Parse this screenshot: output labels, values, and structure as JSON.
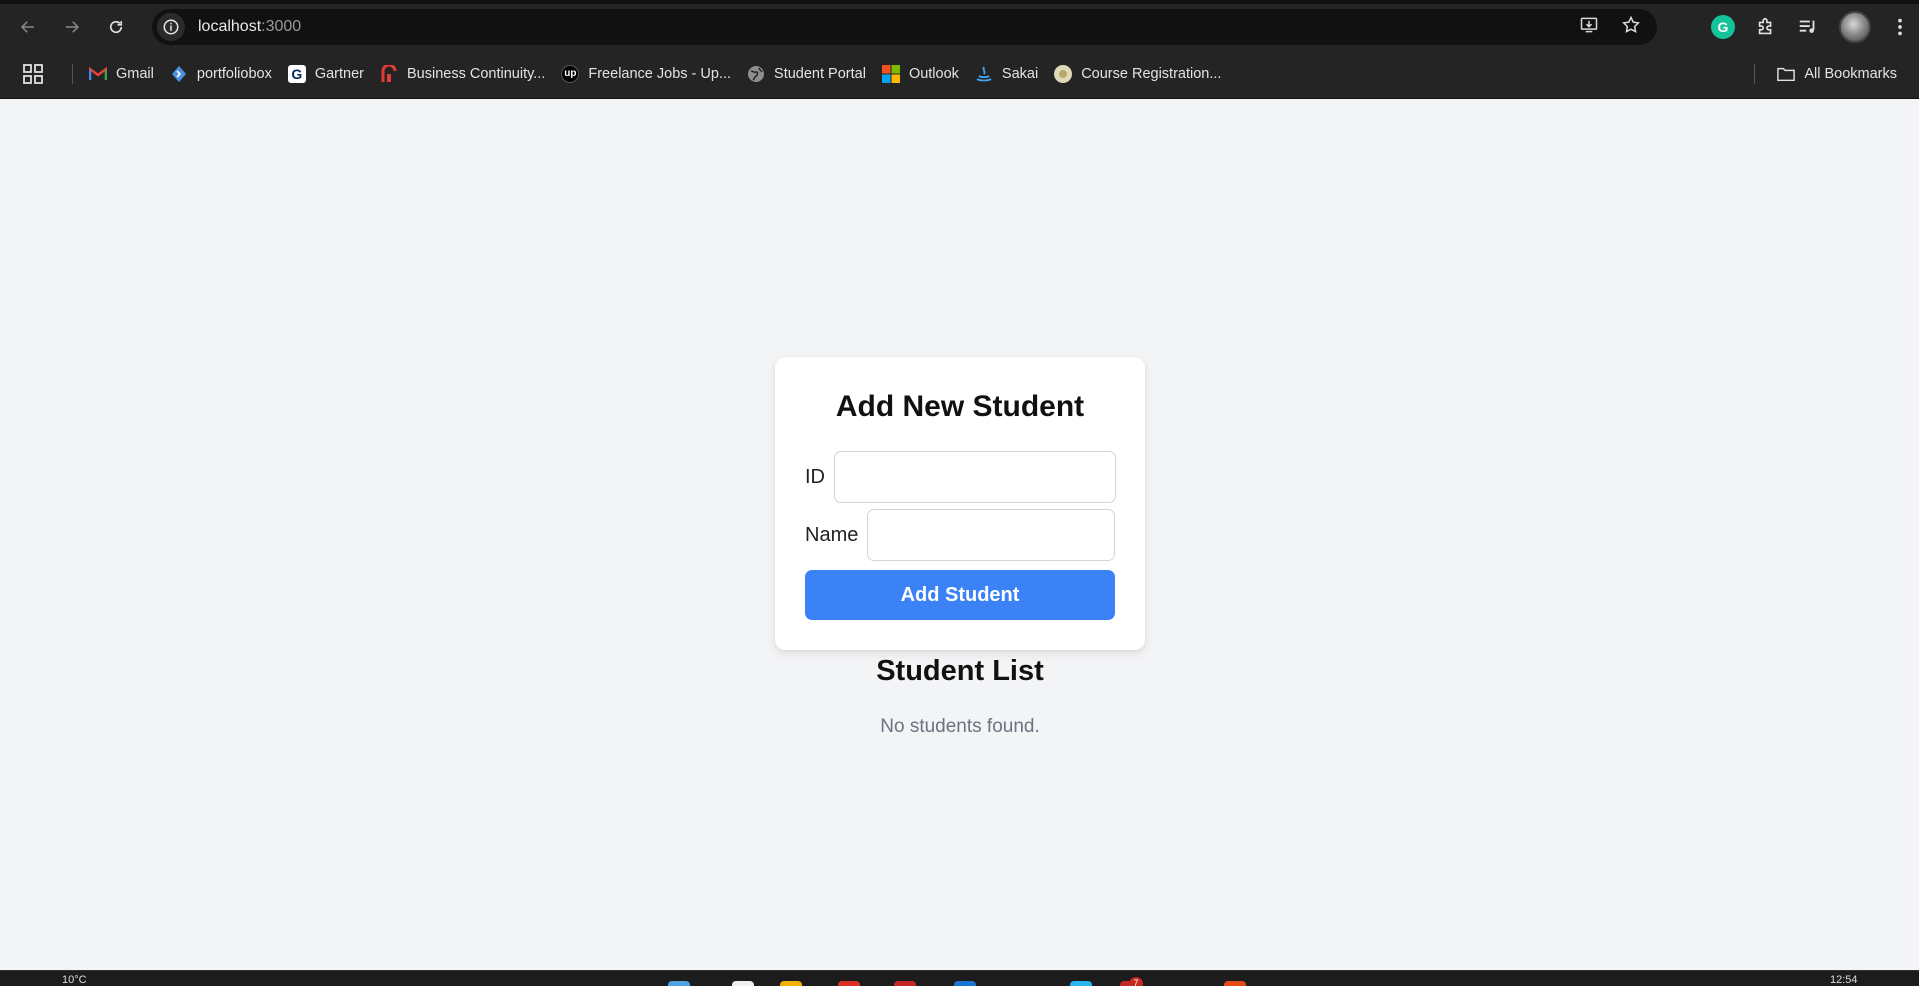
{
  "browser": {
    "url_host": "localhost",
    "url_port": ":3000",
    "bookmarks": [
      {
        "label": "Gmail",
        "icon": "gmail-icon",
        "color": "#ea4335"
      },
      {
        "label": "portfoliobox",
        "icon": "portfoliobox-icon",
        "color": "#4a90e2"
      },
      {
        "label": "Gartner",
        "icon": "gartner-icon",
        "color": "#ffffff"
      },
      {
        "label": "Business Continuity...",
        "icon": "business-continuity-icon",
        "color": "#e53935"
      },
      {
        "label": "Freelance Jobs - Up...",
        "icon": "upwork-icon",
        "color": "#000000"
      },
      {
        "label": "Student Portal",
        "icon": "globe-icon",
        "color": "#9e9e9e"
      },
      {
        "label": "Outlook",
        "icon": "microsoft-icon",
        "color": "#f25022"
      },
      {
        "label": "Sakai",
        "icon": "sakai-icon",
        "color": "#42a5f5"
      },
      {
        "label": "Course Registration...",
        "icon": "course-registration-icon",
        "color": "#e0d9b8"
      }
    ],
    "all_bookmarks_label": "All Bookmarks"
  },
  "form": {
    "title": "Add New Student",
    "id_label": "ID",
    "id_value": "",
    "name_label": "Name",
    "name_value": "",
    "submit_label": "Add Student",
    "accent_color": "#3b82f6"
  },
  "student_list": {
    "title": "Student List",
    "empty_text": "No students found."
  },
  "taskbar": {
    "weather": "10°C",
    "clock": "12:54",
    "notification_count": "7"
  }
}
